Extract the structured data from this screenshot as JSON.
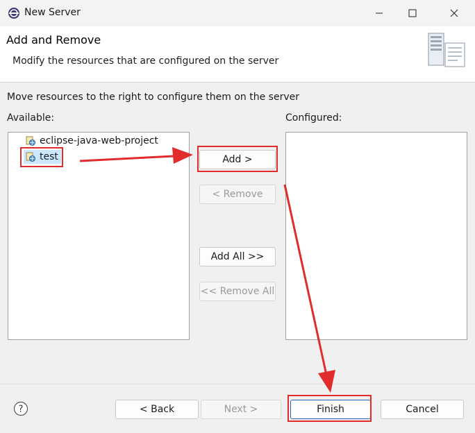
{
  "window": {
    "title": "New Server",
    "minimize_icon": "minimize-icon",
    "maximize_icon": "maximize-icon",
    "close_icon": "close-icon"
  },
  "header": {
    "title": "Add and Remove",
    "description": "Modify the resources that are configured on the server"
  },
  "instruction": "Move resources to the right to configure them on the server",
  "available": {
    "label": "Available:",
    "items": [
      {
        "label": "eclipse-java-web-project",
        "icon": "web-project-icon"
      },
      {
        "label": "test",
        "icon": "web-project-icon",
        "selected": true
      }
    ]
  },
  "configured": {
    "label": "Configured:",
    "items": []
  },
  "buttons": {
    "add": "Add >",
    "remove": "< Remove",
    "add_all": "Add All >>",
    "remove_all": "<< Remove All",
    "back": "< Back",
    "next": "Next >",
    "finish": "Finish",
    "cancel": "Cancel"
  },
  "colors": {
    "annotation": "#e22c2c",
    "selection": "#cce8ff",
    "default_button_border": "#2a62b8"
  }
}
